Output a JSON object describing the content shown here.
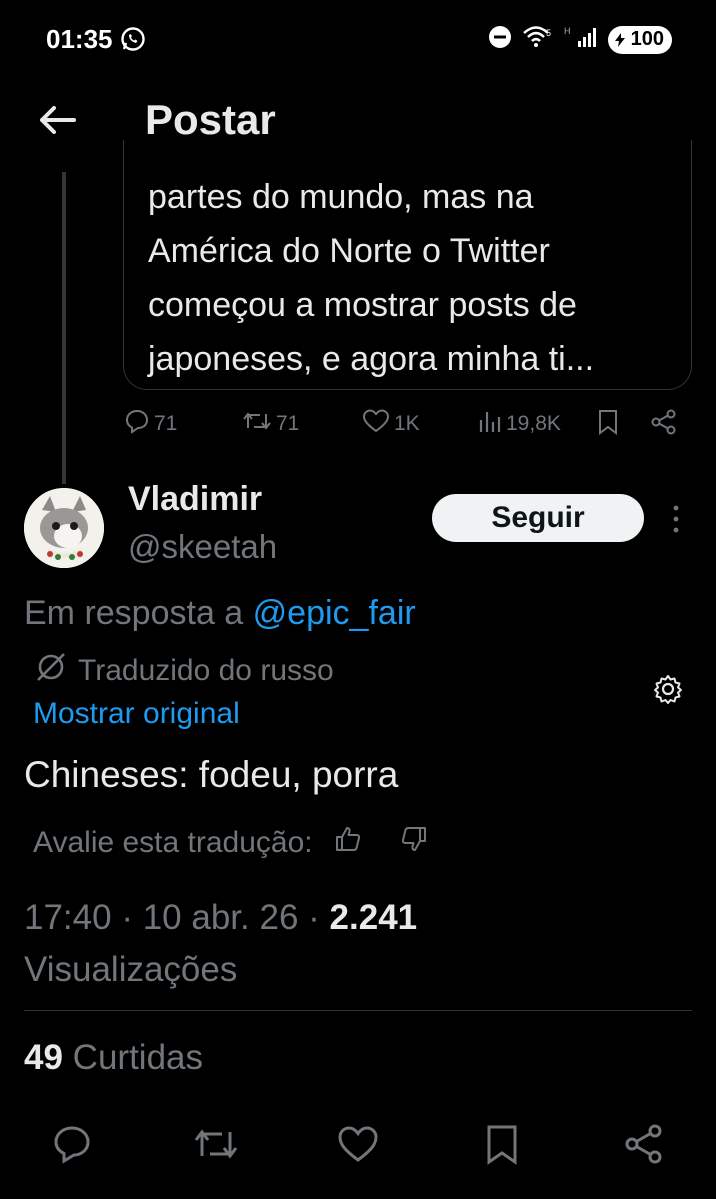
{
  "status_bar": {
    "time": "01:35",
    "battery": "100"
  },
  "header": {
    "title": "Postar"
  },
  "parent_post": {
    "text_lines": [
      "partes do mundo, mas na",
      "América do Norte o Twitter",
      "começou a mostrar posts de",
      "japoneses, e agora minha ti..."
    ],
    "replies": "71",
    "reposts": "71",
    "likes": "1K",
    "views": "19,8K"
  },
  "reply": {
    "author_name": "Vladimir",
    "author_handle": "@skeetah",
    "follow_label": "Seguir",
    "reply_to_prefix": "Em resposta a",
    "reply_to_handle": "@epic_fair",
    "translated_label": "Traduzido do russo",
    "show_original_label": "Mostrar original",
    "text": "Chineses: fodeu, porra",
    "rate_label": "Avalie esta tradução:",
    "time": "17:40",
    "date": "10 abr. 26",
    "views_count": "2.241",
    "views_label": "Visualizações",
    "likes_count": "49",
    "likes_label": "Curtidas"
  },
  "colors": {
    "background": "#000000",
    "text": "#e7e9ea",
    "muted": "#71767b",
    "accent": "#1d9bf0",
    "border": "#2f3336"
  },
  "icons": [
    "whatsapp-icon",
    "dnd-icon",
    "wifi-icon",
    "signal-icon",
    "battery-icon",
    "back-arrow-icon",
    "reply-icon",
    "repost-icon",
    "like-icon",
    "views-icon",
    "bookmark-icon",
    "share-icon",
    "more-icon",
    "translate-icon",
    "gear-icon",
    "thumbs-up-icon",
    "thumbs-down-icon"
  ]
}
